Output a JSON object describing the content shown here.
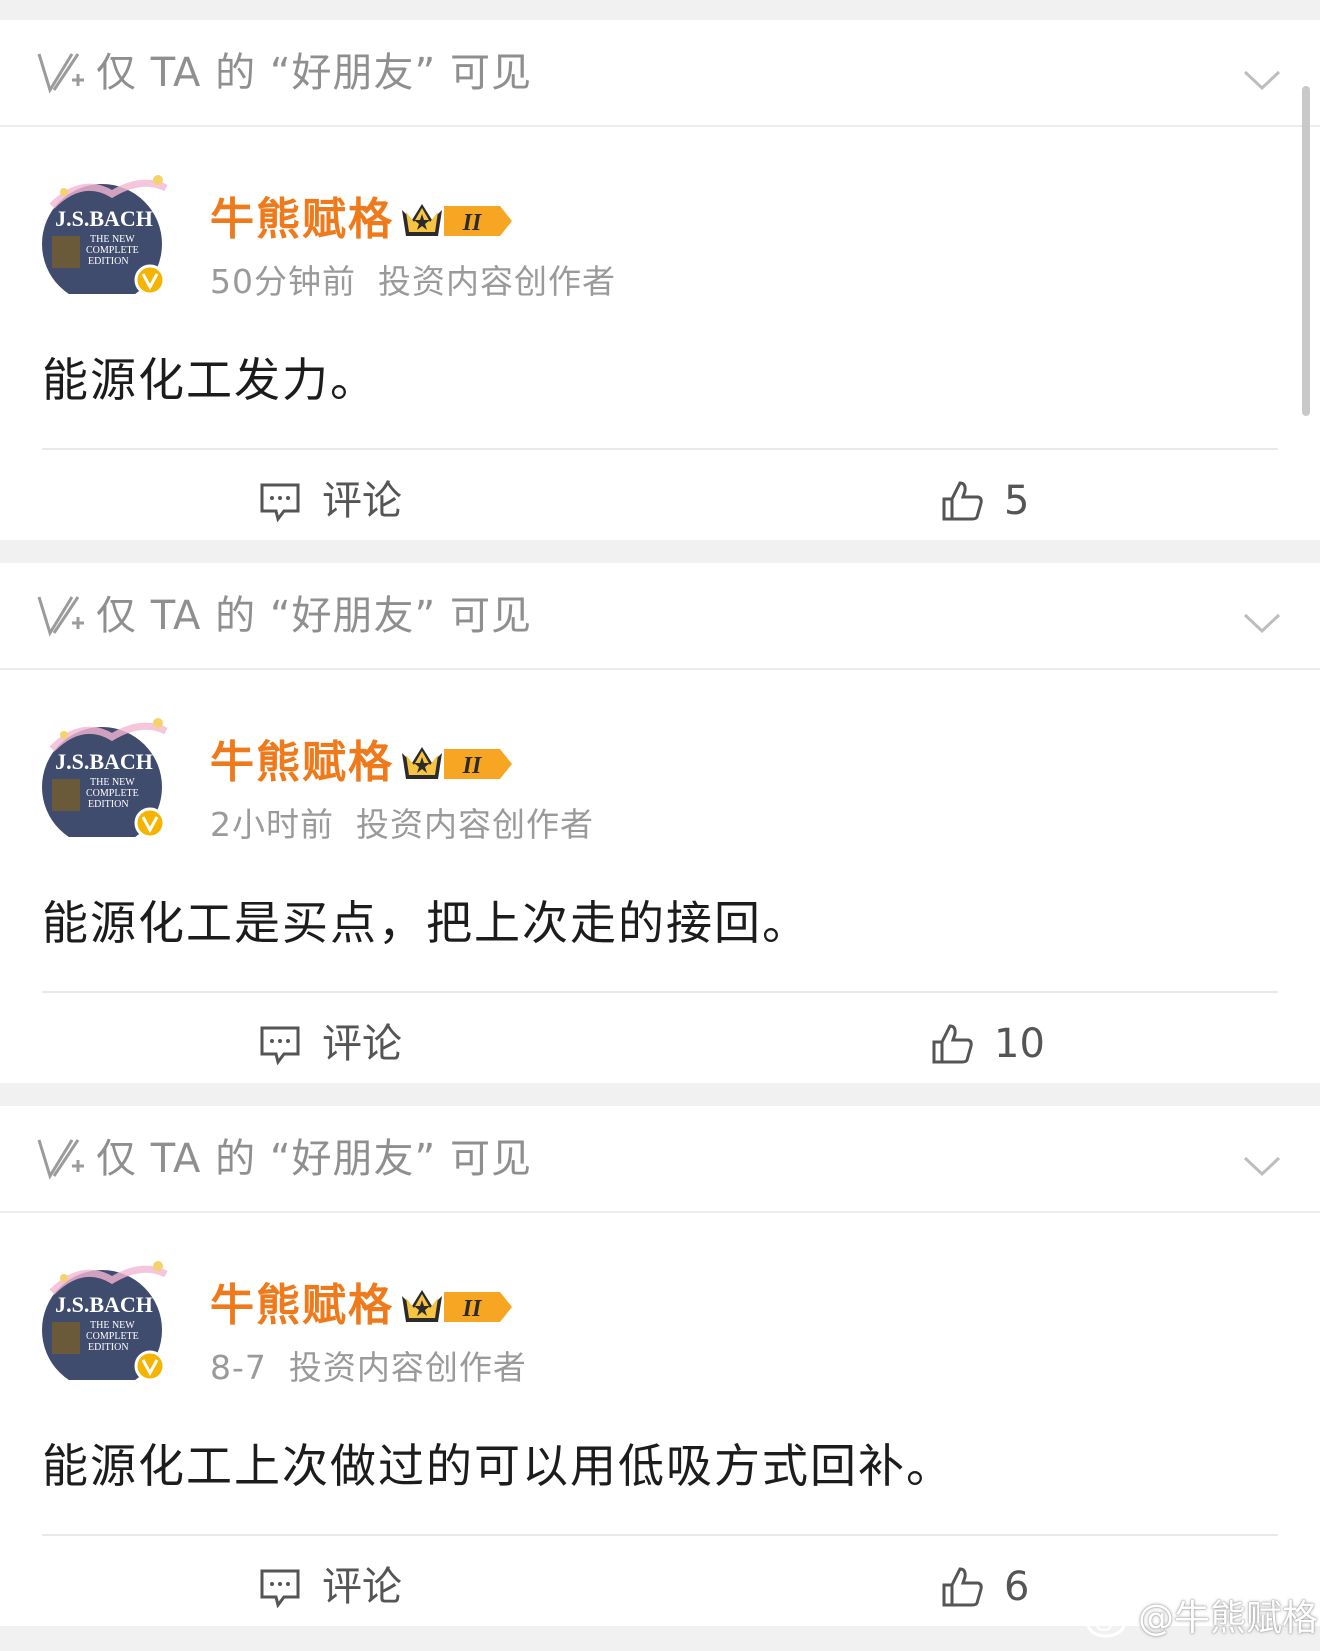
{
  "visibility_label": "仅 TA 的 “好朋友” 可见",
  "posts": [
    {
      "username": "牛熊赋格",
      "badge_level": "II",
      "time": "50分钟前",
      "role": "投资内容创作者",
      "text": "能源化工发力。",
      "comment_label": "评论",
      "likes": "5"
    },
    {
      "username": "牛熊赋格",
      "badge_level": "II",
      "time": "2小时前",
      "role": "投资内容创作者",
      "text": "能源化工是买点，把上次走的接回。",
      "comment_label": "评论",
      "likes": "10"
    },
    {
      "username": "牛熊赋格",
      "badge_level": "II",
      "time": "8-7",
      "role": "投资内容创作者",
      "text": "能源化工上次做过的可以用低吸方式回补。",
      "comment_label": "评论",
      "likes": "6"
    }
  ],
  "avatar_text": {
    "title": "J.S.BACH",
    "sub1": "THE NEW",
    "sub2": "COMPLETE",
    "sub3": "EDITION"
  },
  "watermark": "@牛熊赋格",
  "colors": {
    "username": "#ef7a1b",
    "verified_badge": "#f5b400",
    "background": "#f1f1f1",
    "card": "#ffffff"
  },
  "icons": {
    "visibility": "friends-visible-icon",
    "chevron": "chevron-down-icon",
    "comment": "comment-icon",
    "like": "thumbs-up-icon",
    "verified": "verified-v-icon",
    "vip": "crown-badge-icon"
  }
}
